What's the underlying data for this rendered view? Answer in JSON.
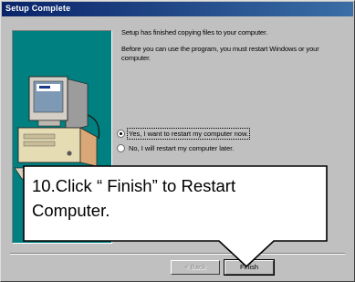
{
  "window": {
    "title": "Setup Complete"
  },
  "dialog": {
    "message_1": "Setup has finished copying files to your computer.",
    "message_2": "Before you can use the program, you must restart Windows or your computer.",
    "options": [
      {
        "label": "Yes, I want to restart my computer now.",
        "checked": true
      },
      {
        "label": "No, I will restart my computer later.",
        "checked": false
      }
    ]
  },
  "buttons": {
    "back_label": "< Back",
    "finish_label": "Finish"
  },
  "callout": {
    "line_1": "10.Click “ Finish” to Restart",
    "line_2": "Computer."
  },
  "colors": {
    "titlebar": "#0a246a",
    "dialog_face": "#c0c0c0",
    "illustration_bg": "#008080",
    "callout_bg": "#ffffff"
  }
}
